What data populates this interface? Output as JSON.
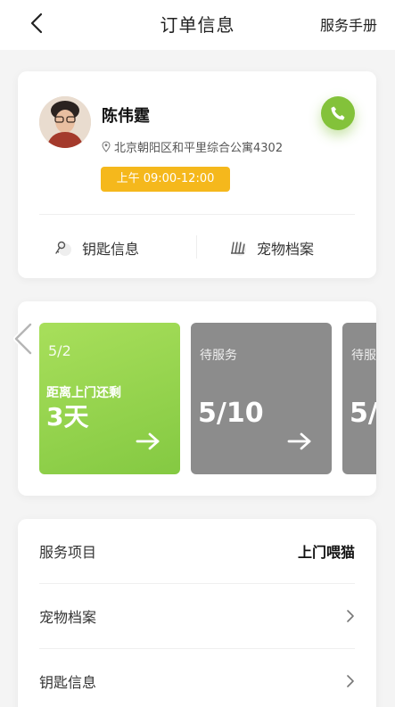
{
  "nav": {
    "title": "订单信息",
    "right_link": "服务手册"
  },
  "customer": {
    "name": "陈伟霆",
    "address": "北京朝阳区和平里综合公寓4302",
    "time_slot": "上午 09:00-12:00"
  },
  "links": {
    "keys": "钥匙信息",
    "pet_profile": "宠物档案"
  },
  "schedule": {
    "tiles": [
      {
        "date_small": "5/2",
        "subtitle": "距离上门还剩",
        "big": "3天"
      },
      {
        "status": "待服务",
        "date": "5/10"
      },
      {
        "status": "待服",
        "date": "5/"
      }
    ]
  },
  "info": {
    "rows": [
      {
        "label": "服务项目",
        "value": "上门喂猫"
      },
      {
        "label": "宠物档案"
      },
      {
        "label": "钥匙信息"
      }
    ]
  },
  "colors": {
    "accent_green": "#83c23a",
    "badge_yellow": "#f5b81c",
    "tile_gray": "#8c8c8c"
  }
}
